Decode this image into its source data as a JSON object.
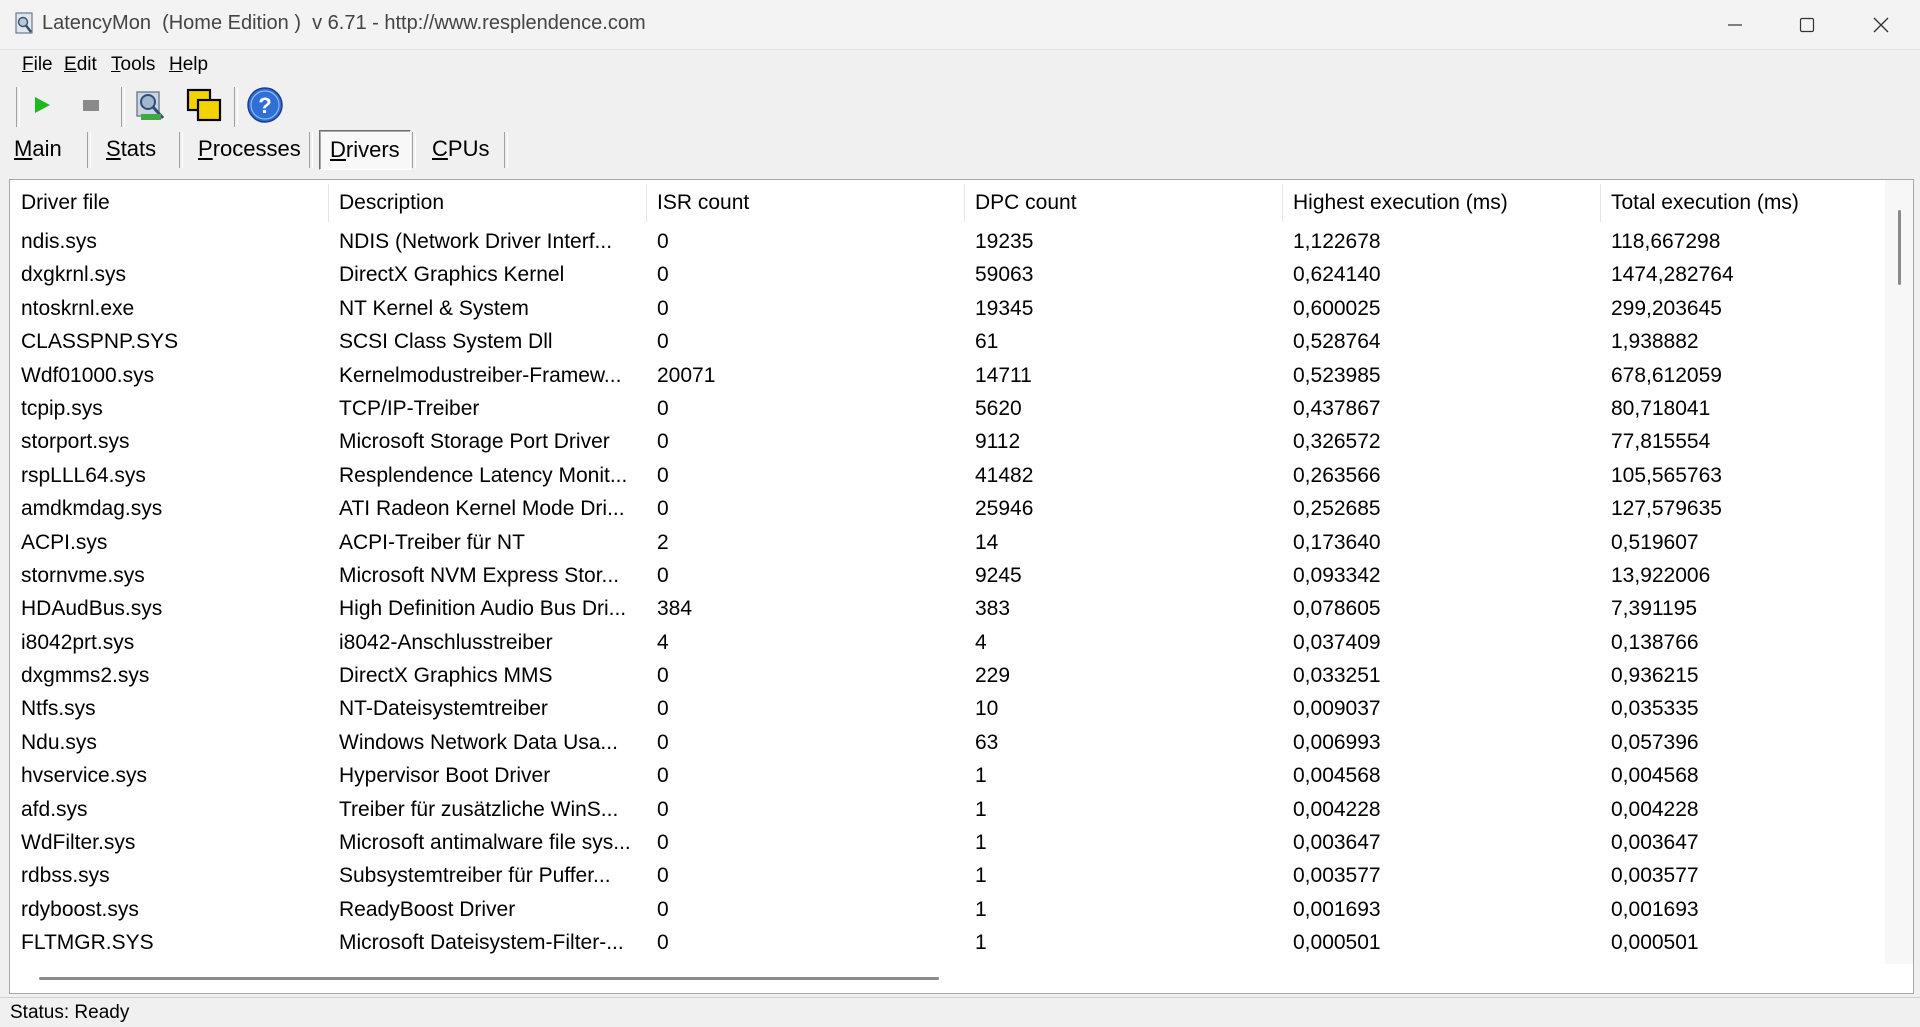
{
  "window": {
    "title": "LatencyMon  (Home Edition )  v 6.71 - http://www.resplendence.com"
  },
  "menu": [
    {
      "key": "F",
      "rest": "ile"
    },
    {
      "key": "E",
      "rest": "dit"
    },
    {
      "key": "T",
      "rest": "ools"
    },
    {
      "key": "H",
      "rest": "elp"
    }
  ],
  "toolbar": {
    "icons": [
      "play-icon",
      "stop-icon",
      "scan-drivers-icon",
      "view-windows-icon",
      "help-icon"
    ]
  },
  "tabs": [
    {
      "key": "M",
      "rest": "ain"
    },
    {
      "key": "S",
      "rest": "tats"
    },
    {
      "key": "P",
      "rest": "rocesses"
    },
    {
      "key": "D",
      "rest": "rivers"
    },
    {
      "key": "C",
      "rest": "PUs"
    }
  ],
  "active_tab": "Drivers",
  "table": {
    "columns": [
      "Driver file",
      "Description",
      "ISR count",
      "DPC count",
      "Highest execution (ms)",
      "Total execution (ms)"
    ],
    "rows": [
      [
        "ndis.sys",
        "NDIS (Network Driver Interf...",
        "0",
        "19235",
        "1,122678",
        "118,667298"
      ],
      [
        "dxgkrnl.sys",
        "DirectX Graphics Kernel",
        "0",
        "59063",
        "0,624140",
        "1474,282764"
      ],
      [
        "ntoskrnl.exe",
        "NT Kernel & System",
        "0",
        "19345",
        "0,600025",
        "299,203645"
      ],
      [
        "CLASSPNP.SYS",
        "SCSI Class System Dll",
        "0",
        "61",
        "0,528764",
        "1,938882"
      ],
      [
        "Wdf01000.sys",
        "Kernelmodustreiber-Framew...",
        "20071",
        "14711",
        "0,523985",
        "678,612059"
      ],
      [
        "tcpip.sys",
        "TCP/IP-Treiber",
        "0",
        "5620",
        "0,437867",
        "80,718041"
      ],
      [
        "storport.sys",
        "Microsoft Storage Port Driver",
        "0",
        "9112",
        "0,326572",
        "77,815554"
      ],
      [
        "rspLLL64.sys",
        "Resplendence Latency Monit...",
        "0",
        "41482",
        "0,263566",
        "105,565763"
      ],
      [
        "amdkmdag.sys",
        "ATI Radeon Kernel Mode Dri...",
        "0",
        "25946",
        "0,252685",
        "127,579635"
      ],
      [
        "ACPI.sys",
        "ACPI-Treiber für NT",
        "2",
        "14",
        "0,173640",
        "0,519607"
      ],
      [
        "stornvme.sys",
        "Microsoft NVM Express Stor...",
        "0",
        "9245",
        "0,093342",
        "13,922006"
      ],
      [
        "HDAudBus.sys",
        "High Definition Audio Bus Dri...",
        "384",
        "383",
        "0,078605",
        "7,391195"
      ],
      [
        "i8042prt.sys",
        "i8042-Anschlusstreiber",
        "4",
        "4",
        "0,037409",
        "0,138766"
      ],
      [
        "dxgmms2.sys",
        "DirectX Graphics MMS",
        "0",
        "229",
        "0,033251",
        "0,936215"
      ],
      [
        "Ntfs.sys",
        "NT-Dateisystemtreiber",
        "0",
        "10",
        "0,009037",
        "0,035335"
      ],
      [
        "Ndu.sys",
        "Windows Network Data Usa...",
        "0",
        "63",
        "0,006993",
        "0,057396"
      ],
      [
        "hvservice.sys",
        "Hypervisor Boot Driver",
        "0",
        "1",
        "0,004568",
        "0,004568"
      ],
      [
        "afd.sys",
        "Treiber für zusätzliche WinS...",
        "0",
        "1",
        "0,004228",
        "0,004228"
      ],
      [
        "WdFilter.sys",
        "Microsoft antimalware file sys...",
        "0",
        "1",
        "0,003647",
        "0,003647"
      ],
      [
        "rdbss.sys",
        "Subsystemtreiber für Puffer...",
        "0",
        "1",
        "0,003577",
        "0,003577"
      ],
      [
        "rdyboost.sys",
        "ReadyBoost Driver",
        "0",
        "1",
        "0,001693",
        "0,001693"
      ],
      [
        "FLTMGR.SYS",
        "Microsoft Dateisystem-Filter-...",
        "0",
        "1",
        "0,000501",
        "0,000501"
      ]
    ]
  },
  "status": {
    "text": "Status: Ready"
  },
  "colors": {
    "play": "#1fb81f",
    "stop": "#8a8a8a",
    "help": "#2f6fd6",
    "view": "#f2d300"
  }
}
